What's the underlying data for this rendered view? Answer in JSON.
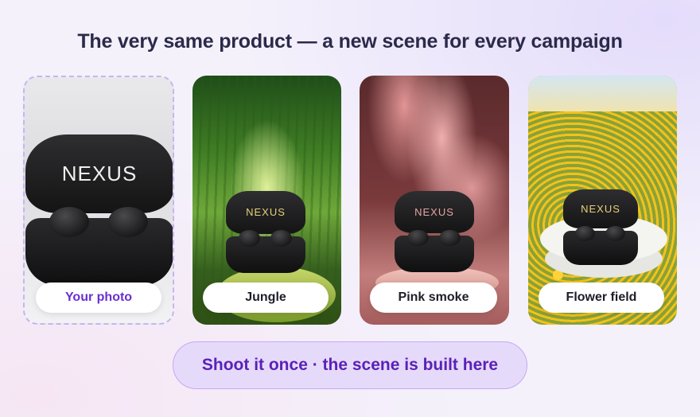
{
  "headline": "The very same product — a new scene for every campaign",
  "cards": [
    {
      "label": "Your photo",
      "scene": "original",
      "brand": "NEXUS"
    },
    {
      "label": "Jungle",
      "scene": "jungle",
      "brand": "NEXUS"
    },
    {
      "label": "Pink smoke",
      "scene": "pink-smoke",
      "brand": "NEXUS"
    },
    {
      "label": "Flower field",
      "scene": "flower-field",
      "brand": "NEXUS"
    }
  ],
  "cta": "Shoot it once · the scene is built here",
  "colors": {
    "accent": "#5a21b8",
    "accent_bg": "#e6dafa",
    "accent_border": "#c6a9f3",
    "headline": "#2b2a4a"
  }
}
